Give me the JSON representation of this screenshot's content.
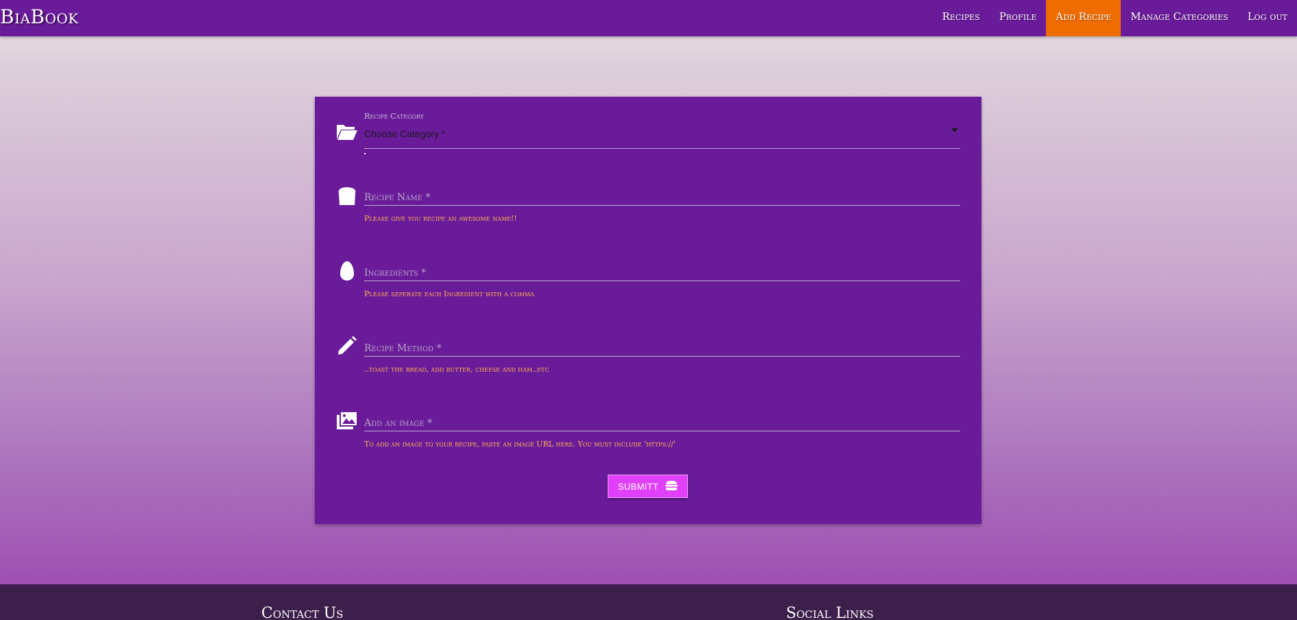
{
  "navbar": {
    "brand": "BiaBook",
    "links": [
      {
        "label": "Recipes",
        "active": false
      },
      {
        "label": "Profile",
        "active": false
      },
      {
        "label": "Add Recipe",
        "active": true
      },
      {
        "label": "Manage Categories",
        "active": false
      },
      {
        "label": "Log out",
        "active": false
      }
    ],
    "color_bg": "#6a1b9a",
    "color_active": "#ef6c00"
  },
  "form": {
    "category": {
      "label": "Recipe Category",
      "selected_value": "Choose Category *",
      "icon": "folder-open-icon"
    },
    "recipe_name": {
      "placeholder": "Recipe Name *",
      "helper": "Please give you recipe an awesome name!!",
      "icon": "bread-icon"
    },
    "ingredients": {
      "placeholder": "Ingredients *",
      "helper": "Please seperate each Ingredient with a comma",
      "icon": "egg-icon"
    },
    "method": {
      "placeholder": "Recipe Method *",
      "helper": "..toast the bread, add butter, cheese and ham..etc",
      "icon": "pencil-icon"
    },
    "image": {
      "placeholder": "Add an image *",
      "helper": "To add an image to your recipe, paste an image URL here. You must include 'https://'",
      "icon": "images-icon"
    },
    "submit": {
      "label": "SUBMITT",
      "icon": "hamburger-icon",
      "color": "#e040fb"
    },
    "helper_color": "#ffb74d"
  },
  "footer": {
    "contact_heading": "Contact Us",
    "social_heading": "Social Links",
    "color_bg": "#3d1f4b"
  }
}
